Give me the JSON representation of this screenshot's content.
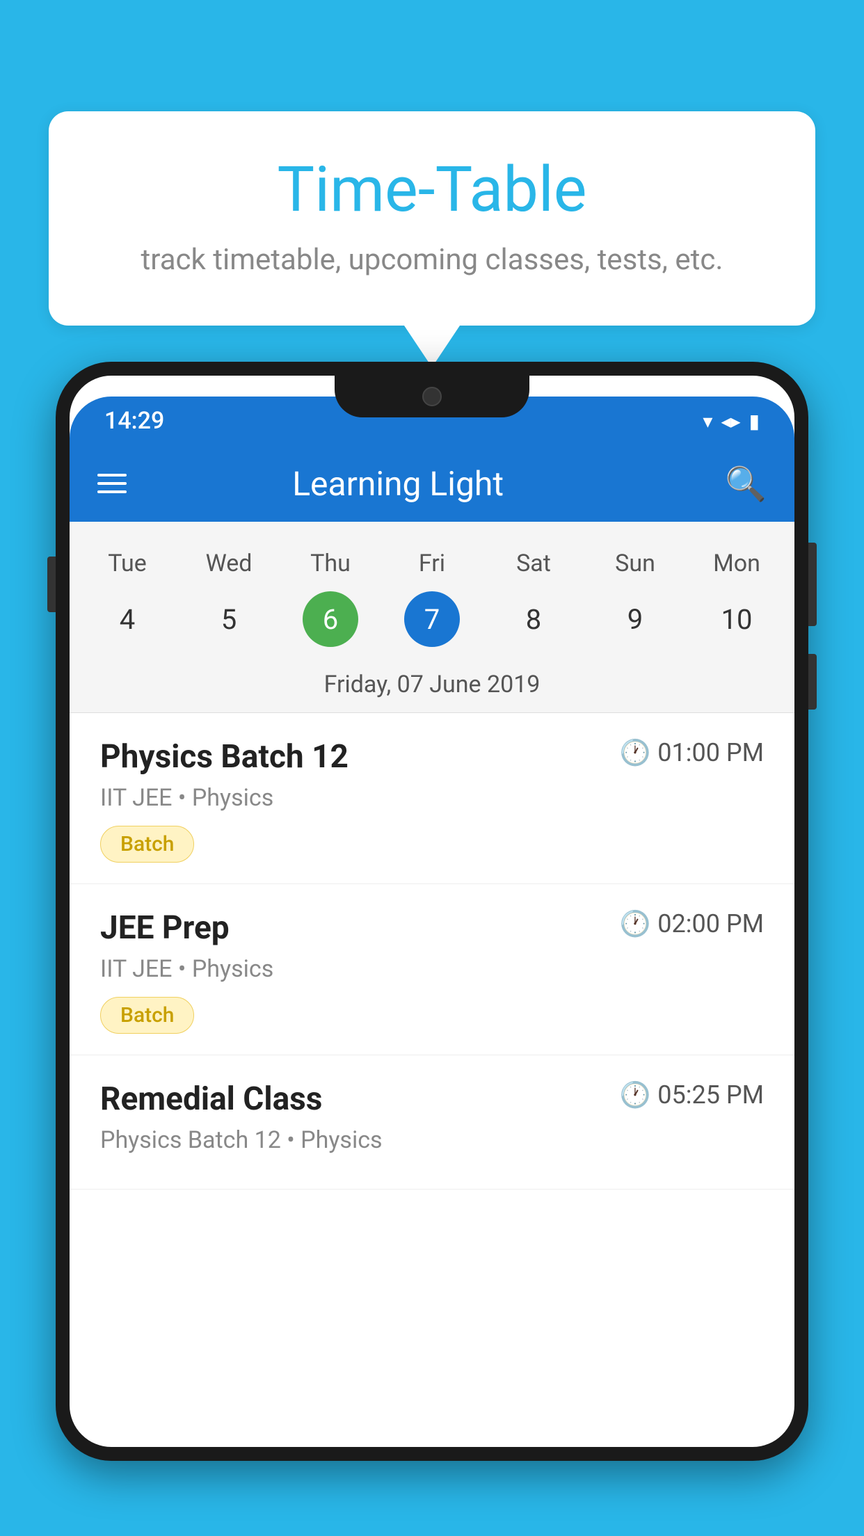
{
  "background_color": "#29b6e8",
  "speech_bubble": {
    "title": "Time-Table",
    "subtitle": "track timetable, upcoming classes, tests, etc."
  },
  "status_bar": {
    "time": "14:29"
  },
  "app_bar": {
    "title": "Learning Light"
  },
  "calendar": {
    "days": [
      "Tue",
      "Wed",
      "Thu",
      "Fri",
      "Sat",
      "Sun",
      "Mon"
    ],
    "dates": [
      {
        "num": "4",
        "state": "normal"
      },
      {
        "num": "5",
        "state": "normal"
      },
      {
        "num": "6",
        "state": "today"
      },
      {
        "num": "7",
        "state": "selected"
      },
      {
        "num": "8",
        "state": "normal"
      },
      {
        "num": "9",
        "state": "normal"
      },
      {
        "num": "10",
        "state": "normal"
      }
    ],
    "selected_date_label": "Friday, 07 June 2019"
  },
  "schedule": {
    "items": [
      {
        "title": "Physics Batch 12",
        "time": "01:00 PM",
        "subtitle": "IIT JEE • Physics",
        "badge": "Batch"
      },
      {
        "title": "JEE Prep",
        "time": "02:00 PM",
        "subtitle": "IIT JEE • Physics",
        "badge": "Batch"
      },
      {
        "title": "Remedial Class",
        "time": "05:25 PM",
        "subtitle": "Physics Batch 12 • Physics",
        "badge": null
      }
    ]
  }
}
